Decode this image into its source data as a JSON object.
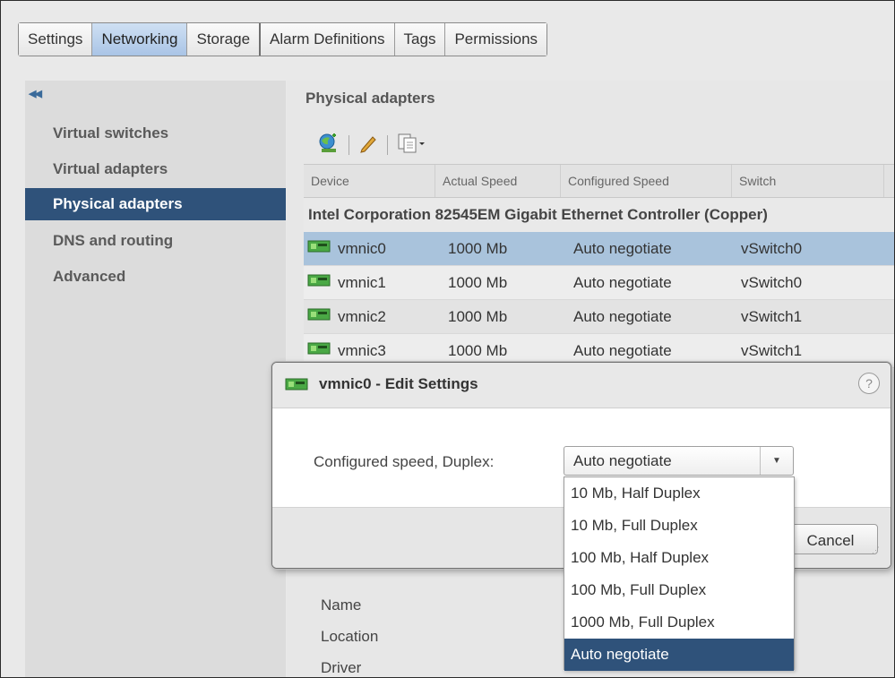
{
  "tabs": [
    "Settings",
    "Networking",
    "Storage",
    "Alarm Definitions",
    "Tags",
    "Permissions"
  ],
  "active_tab": "Networking",
  "nav": {
    "collapse_icon": "double-left-chevron-icon",
    "items": [
      "Virtual switches",
      "Virtual adapters",
      "Physical adapters",
      "DNS and routing",
      "Advanced"
    ],
    "active": "Physical adapters"
  },
  "main": {
    "title": "Physical adapters",
    "toolbar_icons": [
      "add-adapter-icon",
      "edit-icon",
      "copy-dropdown-icon"
    ],
    "columns": [
      "Device",
      "Actual Speed",
      "Configured Speed",
      "Switch"
    ],
    "group": "Intel Corporation 82545EM Gigabit Ethernet Controller (Copper)",
    "rows": [
      {
        "device": "vmnic0",
        "actual": "1000 Mb",
        "configured": "Auto negotiate",
        "switch": "vSwitch0"
      },
      {
        "device": "vmnic1",
        "actual": "1000 Mb",
        "configured": "Auto negotiate",
        "switch": "vSwitch0"
      },
      {
        "device": "vmnic2",
        "actual": "1000 Mb",
        "configured": "Auto negotiate",
        "switch": "vSwitch1"
      },
      {
        "device": "vmnic3",
        "actual": "1000 Mb",
        "configured": "Auto negotiate",
        "switch": "vSwitch1"
      }
    ],
    "props": [
      "Name",
      "Location",
      "Driver"
    ]
  },
  "dialog": {
    "title": "vmnic0 - Edit Settings",
    "help": "?",
    "field_label": "Configured speed, Duplex:",
    "selected": "Auto negotiate",
    "options": [
      "10 Mb, Half Duplex",
      "10 Mb, Full Duplex",
      "100 Mb, Half Duplex",
      "100 Mb, Full Duplex",
      "1000 Mb, Full Duplex",
      "Auto negotiate"
    ],
    "cancel_label": "Cancel"
  },
  "colors": {
    "selection_blue": "#2f527a",
    "row_selected": "#a9c3dc",
    "tab_active": "#b8cfeb"
  }
}
